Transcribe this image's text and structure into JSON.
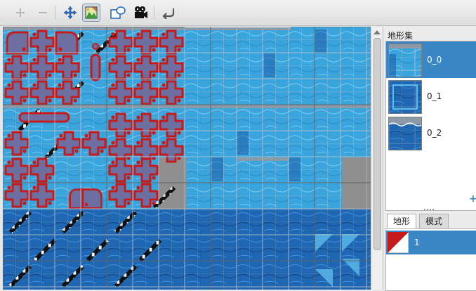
{
  "toolbar": {
    "buttons": [
      {
        "name": "add-icon",
        "enabled": false
      },
      {
        "name": "remove-icon",
        "enabled": false
      },
      {
        "name": "move-arrows-icon",
        "enabled": true
      },
      {
        "name": "terrain-image-icon",
        "enabled": true,
        "active": true
      },
      {
        "name": "shape-overlay-icon",
        "enabled": true
      },
      {
        "name": "video-camera-icon",
        "enabled": true
      },
      {
        "name": "undo-arrow-icon",
        "enabled": true
      }
    ]
  },
  "tileset": {
    "colors": {
      "water_light": "#3aa4dc",
      "water_mid": "#2f86c8",
      "water_dark": "#1c5fa8",
      "grid": "#9fb6c7",
      "red": "#c71a1a",
      "grey": "#8f8f8f"
    }
  },
  "right_panel": {
    "title": "地形集",
    "terrains": [
      {
        "label": "0_0",
        "selected": true
      },
      {
        "label": "0_1",
        "selected": false
      },
      {
        "label": "0_2",
        "selected": false
      }
    ],
    "add_label": "+",
    "tabs": [
      {
        "label": "地形",
        "active": true
      },
      {
        "label": "模式",
        "active": false
      }
    ],
    "wang_items": [
      {
        "label": "1",
        "color": "#c71a1a"
      }
    ]
  }
}
